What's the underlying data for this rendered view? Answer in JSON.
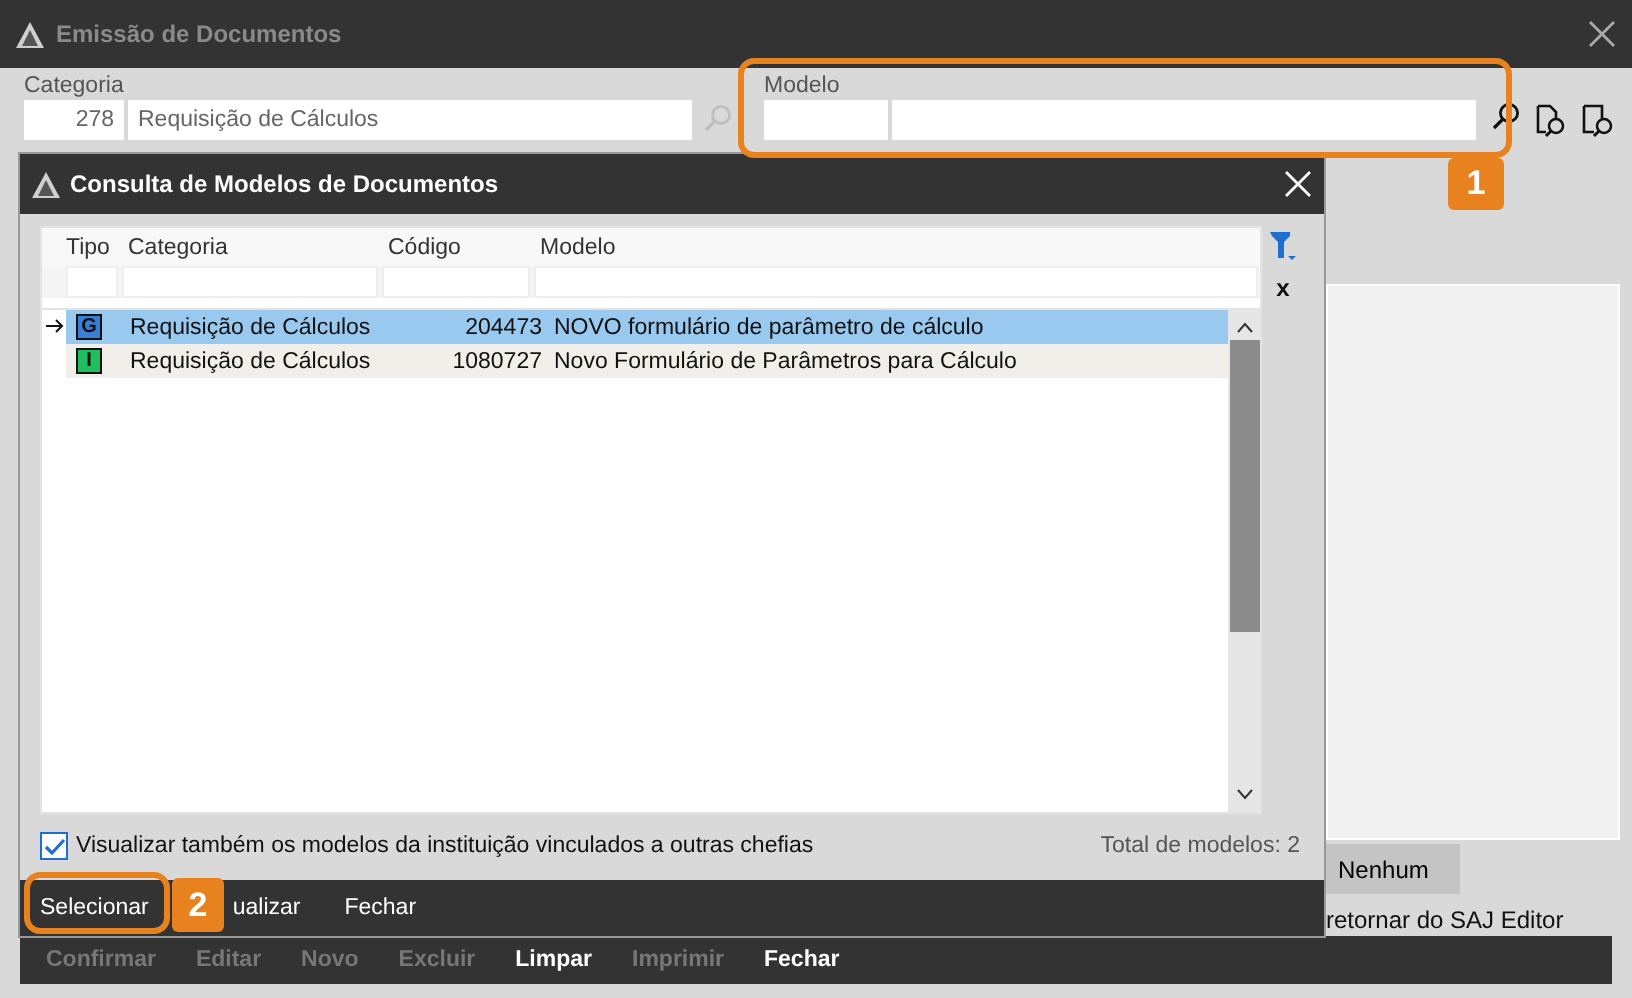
{
  "window": {
    "title": "Emissão de Documentos"
  },
  "categoria": {
    "label": "Categoria",
    "code": "278",
    "name": "Requisição de Cálculos"
  },
  "modelo": {
    "label": "Modelo"
  },
  "dialog": {
    "title": "Consulta de Modelos de Documentos",
    "columns": [
      "Tipo",
      "Categoria",
      "Código",
      "Modelo"
    ],
    "rows": [
      {
        "type_letter": "G",
        "color": "#3a7fd5",
        "categoria": "Requisição de Cálculos",
        "codigo": "204473",
        "modelo": "NOVO formulário de parâmetro de cálculo",
        "selected": true
      },
      {
        "type_letter": "I",
        "color": "#1fbf5f",
        "categoria": "Requisição de Cálculos",
        "codigo": "1080727",
        "modelo": "Novo Formulário de Parâmetros para Cálculo",
        "selected": false
      }
    ],
    "clear_filter": "x",
    "option": {
      "label": "Visualizar também os modelos da instituição vinculados a outras chefias",
      "checked": true
    },
    "total": "Total de modelos: 2",
    "buttons": [
      "Selecionar",
      "ualizar",
      "Fechar"
    ]
  },
  "side": {
    "button": "Nenhum",
    "note": "retornar do SAJ Editor"
  },
  "toolbar": [
    {
      "label": "Confirmar",
      "disabled": true
    },
    {
      "label": "Editar",
      "disabled": true
    },
    {
      "label": "Novo",
      "disabled": true
    },
    {
      "label": "Excluir",
      "disabled": true
    },
    {
      "label": "Limpar",
      "disabled": false
    },
    {
      "label": "Imprimir",
      "disabled": true
    },
    {
      "label": "Fechar",
      "disabled": false
    }
  ],
  "annotations": [
    {
      "label": "1"
    },
    {
      "label": "2"
    }
  ]
}
